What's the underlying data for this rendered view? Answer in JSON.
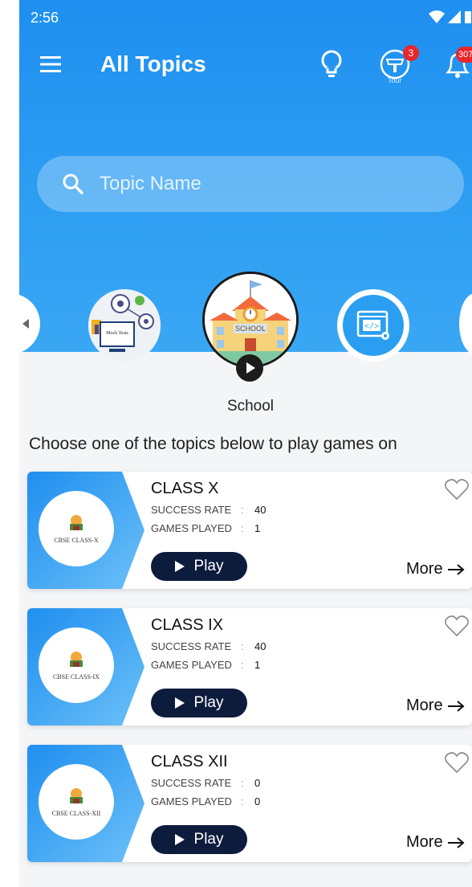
{
  "status_bar": {
    "time": "2:56"
  },
  "header": {
    "title": "All Topics",
    "tour_badge": "3",
    "tour_label": "Tour",
    "notification_badge": "307"
  },
  "search": {
    "placeholder": "Topic Name"
  },
  "categories": {
    "selected_label": "School",
    "mock_tests_caption": "Mock Tests",
    "school_sign": "SCHOOL"
  },
  "instructions": "Choose one of the topics below to play games on",
  "labels": {
    "success_rate": "SUCCESS RATE",
    "games_played": "GAMES PLAYED",
    "separator": ":",
    "play": "Play",
    "more": "More"
  },
  "topics": [
    {
      "title": "CLASS X",
      "thumb_caption": "CBSE CLASS-X",
      "success_rate": "40",
      "games_played": "1"
    },
    {
      "title": "CLASS IX",
      "thumb_caption": "CBSE CLASS-IX",
      "success_rate": "40",
      "games_played": "1"
    },
    {
      "title": "CLASS XII",
      "thumb_caption": "CBSE CLASS-XII",
      "success_rate": "0",
      "games_played": "0"
    }
  ],
  "colors": {
    "header_blue": "#1f8ff0",
    "play_button": "#0d1b3d",
    "badge_red": "#e8262d"
  }
}
